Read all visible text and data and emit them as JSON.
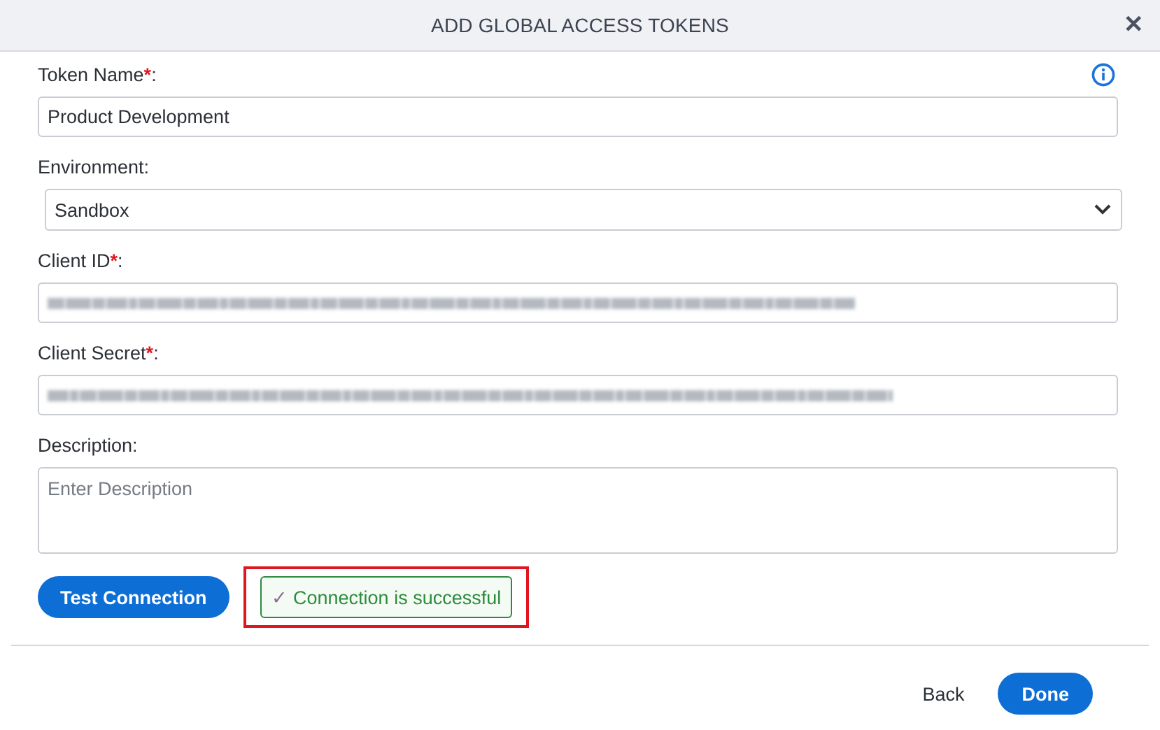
{
  "dialog": {
    "title": "ADD GLOBAL ACCESS TOKENS",
    "close": "✕"
  },
  "fields": [
    {
      "kind": "text",
      "label": "Token Name",
      "required_mark": "*",
      "label_end": ":",
      "value": "Product Development",
      "info": true
    },
    {
      "kind": "select",
      "label": "Environment",
      "label_end": ":",
      "value": "Sandbox"
    },
    {
      "kind": "text",
      "label": "Client ID",
      "required_mark": "*",
      "label_end": ":",
      "blurred": true
    },
    {
      "kind": "text",
      "label": "Client Secret",
      "required_mark": "*",
      "label_end": ":",
      "blurred": true
    },
    {
      "kind": "textarea",
      "label": "Description",
      "label_end": ":",
      "placeholder": "Enter Description"
    }
  ],
  "test_button": "Test Connection",
  "status": {
    "icon": "✓",
    "text": "Connection is successful",
    "highlighted": true
  },
  "footer": {
    "back": "Back",
    "done": "Done"
  }
}
